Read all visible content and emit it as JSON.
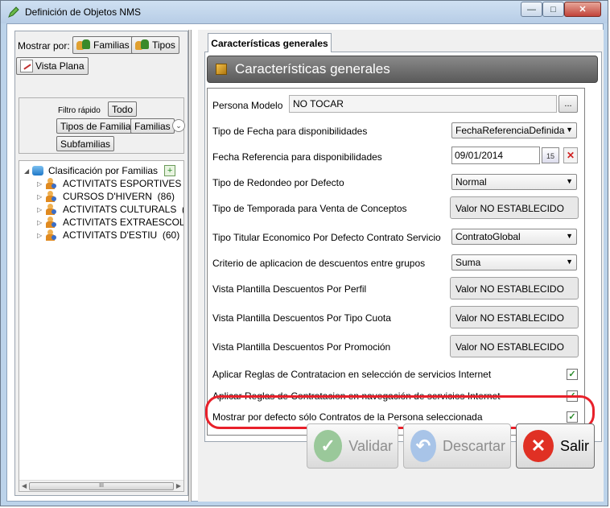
{
  "window": {
    "title": "Definición de Objetos NMS",
    "controls": {
      "minimize": "—",
      "maximize": "□",
      "close": "✕"
    }
  },
  "left_panel": {
    "show_by_label": "Mostrar por:",
    "buttons": {
      "families": "Familias",
      "types": "Tipos",
      "flat_view": "Vista Plana"
    },
    "quick_filter": {
      "label": "Filtro rápido",
      "options": {
        "all": "Todo",
        "family_types": "Tipos de Familia",
        "families": "Familias",
        "subfamilies": "Subfamilias"
      }
    },
    "tree": {
      "root": "Clasificación por Familias",
      "items": [
        {
          "name": "ACTIVITATS ESPORTIVES",
          "count": ""
        },
        {
          "name": "CURSOS D'HIVERN",
          "count": "(86)"
        },
        {
          "name": "ACTIVITATS CULTURALS",
          "count": "("
        },
        {
          "name": "ACTIVITATS EXTRAESCOLA",
          "count": ""
        },
        {
          "name": "ACTIVITATS D'ESTIU",
          "count": "(60)"
        }
      ]
    },
    "scrollbar_grip": "III"
  },
  "tab": {
    "label": "Características generales"
  },
  "section": {
    "title": "Características generales"
  },
  "fields": {
    "persona_modelo": {
      "label": "Persona Modelo",
      "value": "NO TOCAR",
      "button": "..."
    },
    "tipo_fecha": {
      "label": "Tipo de Fecha para disponibilidades",
      "value": "FechaReferenciaDefinida"
    },
    "fecha_referencia": {
      "label": "Fecha Referencia para disponibilidades",
      "value": "09/01/2014",
      "calendar_day": "15"
    },
    "tipo_redondeo": {
      "label": "Tipo de Redondeo por Defecto",
      "value": "Normal"
    },
    "tipo_temporada": {
      "label": "Tipo de Temporada para Venta de Conceptos",
      "value": "Valor NO ESTABLECIDO"
    },
    "tipo_titular": {
      "label": "Tipo Titular Economico Por Defecto Contrato Servicio",
      "value": "ContratoGlobal"
    },
    "criterio_descuentos": {
      "label": "Criterio de aplicacion de descuentos entre grupos",
      "value": "Suma"
    },
    "vista_perfil": {
      "label": "Vista Plantilla Descuentos Por Perfil",
      "value": "Valor NO ESTABLECIDO"
    },
    "vista_tipo_cuota": {
      "label": "Vista Plantilla Descuentos Por Tipo Cuota",
      "value": "Valor NO ESTABLECIDO"
    },
    "vista_promocion": {
      "label": "Vista Plantilla Descuentos Por Promoción",
      "value": "Valor NO ESTABLECIDO"
    },
    "reglas_seleccion": {
      "label": "Aplicar Reglas de Contratacion en selección de servicios Internet",
      "checked": true
    },
    "reglas_navegacion": {
      "label": "Aplicar Reglas de Contratacion en navegación de servicios Internet",
      "checked": true
    },
    "mostrar_contratos": {
      "label": "Mostrar por defecto sólo Contratos de la Persona seleccionada",
      "checked": true
    }
  },
  "actions": {
    "validate": "Validar",
    "discard": "Descartar",
    "exit": "Salir"
  },
  "colors": {
    "highlight_oval": "#e8202a",
    "check": "#2a8a2a",
    "exit_icon": "#e03024",
    "validate_icon": "#3aaa3a",
    "discard_icon": "#4a90e0"
  },
  "icons": {
    "title": "pencil-icon",
    "families": "people-icon",
    "flat_view": "list-icon",
    "expand": "chevron-down-icon",
    "tree_root": "database-icon",
    "tree_item": "person-group-icon",
    "calendar": "calendar-icon",
    "clear": "red-x-icon"
  }
}
